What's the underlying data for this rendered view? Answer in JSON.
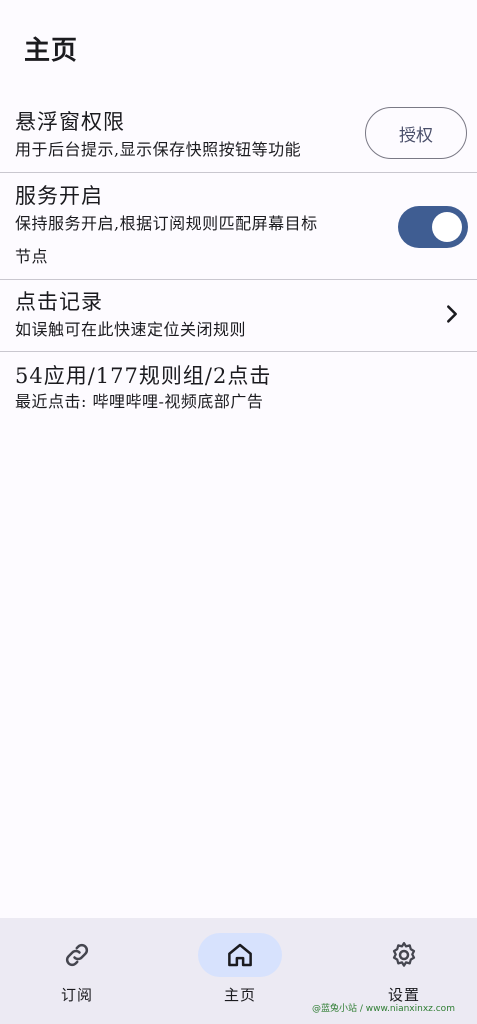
{
  "page": {
    "title": "主页"
  },
  "overlay": {
    "title": "悬浮窗权限",
    "desc": "用于后台提示,显示保存快照按钮等功能",
    "button_label": "授权"
  },
  "service": {
    "title": "服务开启",
    "desc_line1": "保持服务开启,根据订阅规则匹配屏幕目标",
    "desc_line2": "节点",
    "enabled": true
  },
  "click_log": {
    "title": "点击记录",
    "desc": "如误触可在此快速定位关闭规则"
  },
  "stats": {
    "title": "54应用/177规则组/2点击",
    "desc": "最近点击: 哔哩哔哩-视频底部广告"
  },
  "nav": {
    "items": [
      {
        "label": "订阅",
        "icon": "link-icon",
        "active": false
      },
      {
        "label": "主页",
        "icon": "home-icon",
        "active": true
      },
      {
        "label": "设置",
        "icon": "gear-icon",
        "active": false
      }
    ]
  },
  "watermark": "@蓝兔小站 / www.nianxinxz.com",
  "colors": {
    "accent": "#3f5d92",
    "active_pill": "#d7e2fd",
    "nav_bg": "#eceaf3",
    "background": "#fdfbff"
  }
}
